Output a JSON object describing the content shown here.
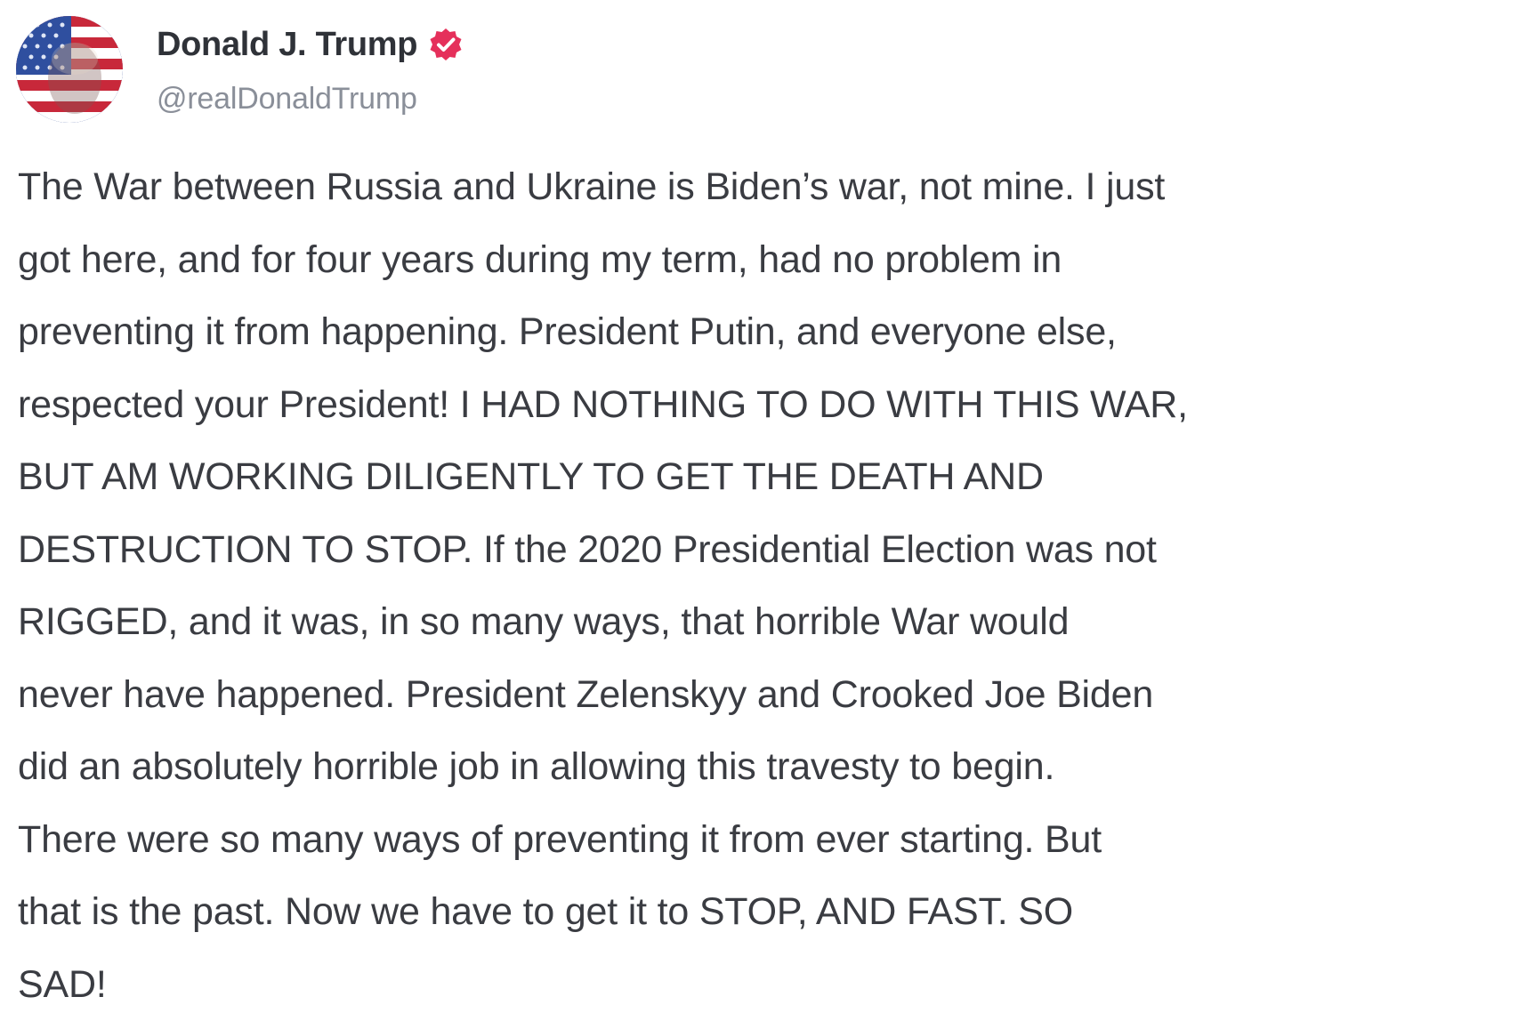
{
  "post": {
    "author": {
      "display_name": "Donald J. Trump",
      "handle": "@realDonaldTrump",
      "verified": true,
      "avatar_icon": "flag-portrait-avatar"
    },
    "body_lines": [
      "The War between Russia and Ukraine is Biden’s war, not mine. I just",
      "got here, and for four years during my term, had no problem in",
      "preventing it from happening. President Putin, and everyone else,",
      "respected your President! I HAD NOTHING TO DO WITH THIS WAR,",
      "BUT AM WORKING DILIGENTLY TO GET THE DEATH AND",
      "DESTRUCTION TO STOP. If the 2020 Presidential Election was not",
      "RIGGED, and it was, in so many ways, that horrible War would",
      "never have happened. President Zelenskyy and Crooked Joe Biden",
      "did an absolutely horrible job in allowing this travesty to begin.",
      "There were so many ways of preventing it from ever starting. But",
      "that is the past. Now we have to get it to STOP, AND FAST. SO",
      "SAD!"
    ]
  },
  "colors": {
    "verified_badge": "#e5305b",
    "text": "#3a3c42",
    "handle": "#8a8f99"
  }
}
